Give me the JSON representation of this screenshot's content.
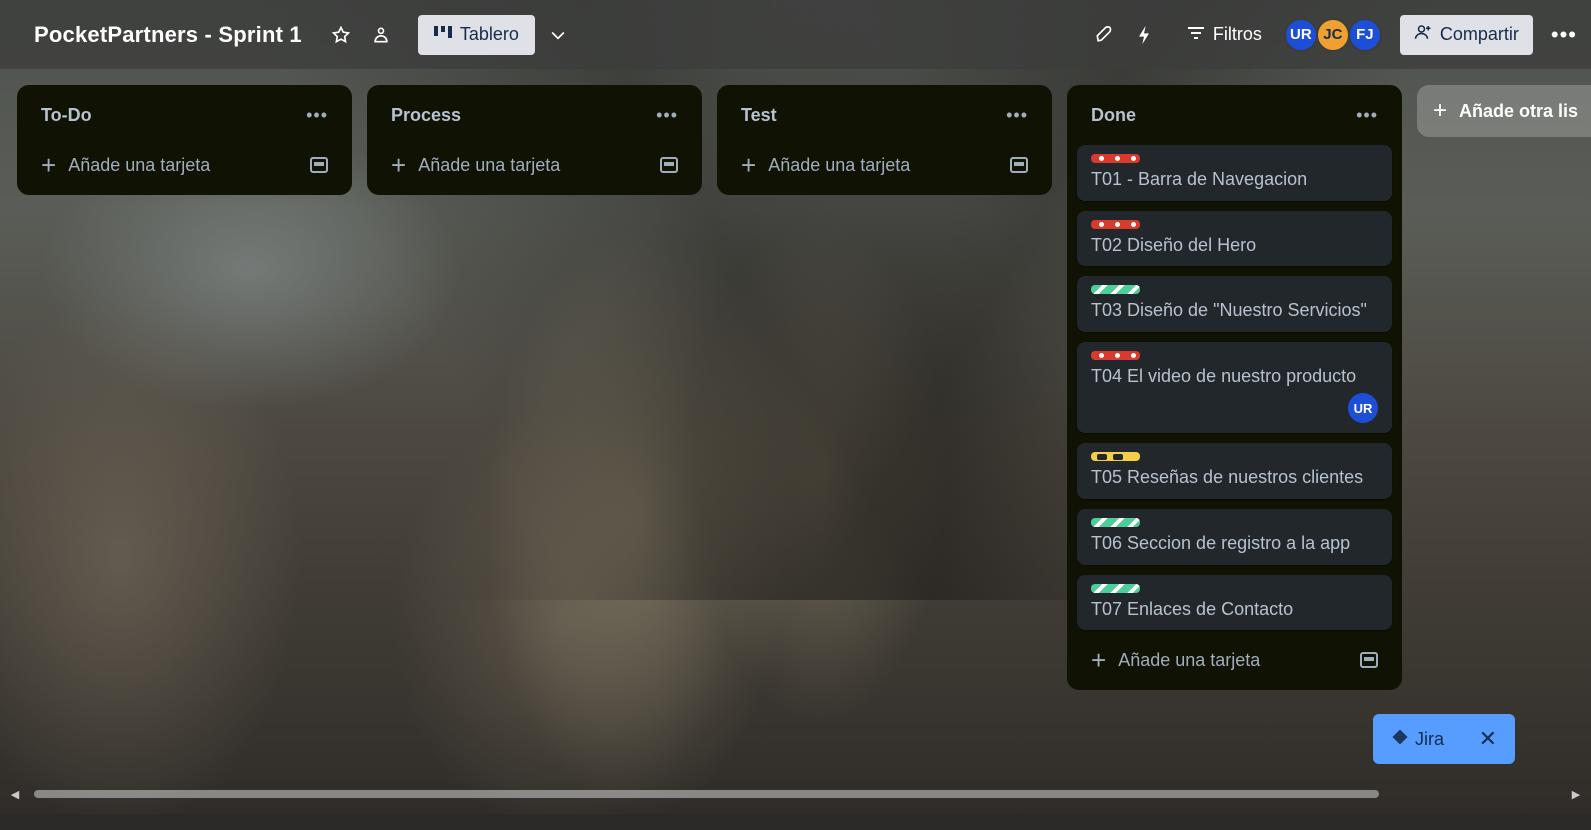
{
  "board": {
    "title": "PocketPartners - Sprint 1",
    "view_label": "Tablero",
    "filters_label": "Filtros",
    "share_label": "Compartir",
    "members": [
      "UR",
      "JC",
      "FJ"
    ]
  },
  "lists": [
    {
      "title": "To-Do",
      "add_label": "Añade una tarjeta",
      "cards": []
    },
    {
      "title": "Process",
      "add_label": "Añade una tarjeta",
      "cards": []
    },
    {
      "title": "Test",
      "add_label": "Añade una tarjeta",
      "cards": []
    },
    {
      "title": "Done",
      "add_label": "Añade una tarjeta",
      "cards": [
        {
          "title": "T01 - Barra de Navegacion",
          "label_color": "red"
        },
        {
          "title": "T02 Diseño del Hero",
          "label_color": "red"
        },
        {
          "title": "T03 Diseño de \"Nuestro Servicios\"",
          "label_color": "green"
        },
        {
          "title": "T04 El video de nuestro producto",
          "label_color": "red",
          "member": "UR"
        },
        {
          "title": "T05 Reseñas de nuestros clientes",
          "label_color": "yellow"
        },
        {
          "title": "T06 Seccion de registro a la app",
          "label_color": "green"
        },
        {
          "title": "T07 Enlaces de Contacto",
          "label_color": "green"
        }
      ]
    }
  ],
  "add_list_label": "Añade otra lis",
  "jira": {
    "label": "Jira"
  },
  "colors": {
    "label_red": "#d93a2b",
    "label_green": "#4bce97",
    "label_yellow": "#f5cd47",
    "jira_bg": "#579dff",
    "list_bg": "#101204",
    "card_bg": "#22272b"
  }
}
